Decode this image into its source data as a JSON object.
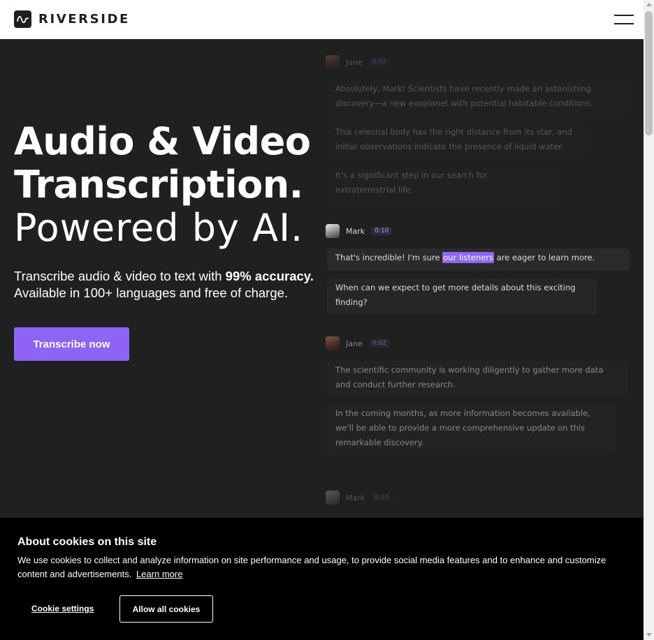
{
  "header": {
    "brand": "RIVERSIDE",
    "logo_icon": "waveform-icon",
    "menu_icon": "hamburger-menu-icon"
  },
  "hero": {
    "title_line1": "Audio & Video",
    "title_line2": "Transcription.",
    "title_line3": "Powered by AI.",
    "subtitle_part1": "Transcribe audio & video to text with ",
    "subtitle_bold": "99% accuracy.",
    "subtitle_part2": "Available in 100+ languages and free of charge.",
    "cta_label": "Transcribe now"
  },
  "transcript": {
    "blocks": [
      {
        "speaker": "Jane",
        "time": "0:02",
        "messages": [
          "Absolutely, Mark! Scientists have recently made an astonishing discovery—a new exoplanet with potential habitable conditions.",
          "This celestial body has the right distance from its star, and initial observations indicate the presence of liquid water.",
          "It's a significant step in our search for extraterrestrial life."
        ]
      },
      {
        "speaker": "Mark",
        "time": "0:10",
        "messages": [
          "That's incredible! I'm sure ",
          "When can we expect to get more details about this exciting finding?"
        ],
        "highlight": "our listeners",
        "after_highlight": " are eager to learn more."
      },
      {
        "speaker": "Jane",
        "time": "0:02",
        "messages": [
          "The scientific community is working diligently to gather more data and conduct further research.",
          "In the coming months, as more information becomes available, we'll be able to provide a more comprehensive update on this remarkable discovery."
        ]
      },
      {
        "speaker": "Mark",
        "time": "0:10",
        "messages": []
      }
    ]
  },
  "cookies": {
    "title": "About cookies on this site",
    "text": "We use cookies to collect and analyze information on site performance and usage, to provide social media features and to enhance and customize content and advertisements.",
    "learn_more": "Learn more",
    "settings_label": "Cookie settings",
    "allow_label": "Allow all cookies"
  },
  "colors": {
    "background": "#202020",
    "accent": "#8d64f4",
    "header_bg": "#ffffff",
    "cookie_bg": "#000000"
  }
}
